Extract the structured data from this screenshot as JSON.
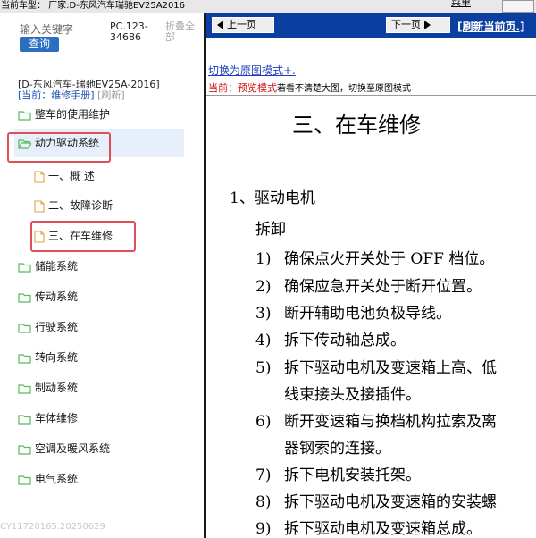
{
  "topbar": {
    "current_model": "当前车型： 厂家:D-东风汽车瑞驰EV25A2016",
    "menu_label": "菜单"
  },
  "left": {
    "search_label": "输入关键字",
    "search_button": "查询",
    "pc_code_line1": "PC.123-",
    "pc_code_line2": "34686",
    "fold_line1": "折叠全",
    "fold_line2": "部",
    "model_name": "[D-东风汽车-瑞驰EV25A-2016]",
    "mode_current": "[当前：维修手册]",
    "mode_refresh": "[刷新]",
    "tree": [
      {
        "label": "整车的使用维护"
      },
      {
        "label": "动力驱动系统"
      },
      {
        "label": "一、概 述"
      },
      {
        "label": "二、故障诊断"
      },
      {
        "label": "三、在车维修"
      },
      {
        "label": "储能系统"
      },
      {
        "label": "传动系统"
      },
      {
        "label": "行驶系统"
      },
      {
        "label": "转向系统"
      },
      {
        "label": "制动系统"
      },
      {
        "label": "车体维修"
      },
      {
        "label": "空调及暖风系统"
      },
      {
        "label": "电气系统"
      }
    ],
    "footer": "CY11720165.20250629"
  },
  "right": {
    "prev_label": "上一页",
    "next_label": "下一页",
    "home_link": "[刷新当前页.]",
    "switch_link": "切换为原图模式+.",
    "current_prefix": "当前：",
    "current_mode": "预览模式",
    "current_hint": "若看不清楚大图，切换至原图模式",
    "doc_title": "三、在车维修",
    "section": "1、驱动电机",
    "subsection": "拆卸",
    "steps": [
      {
        "n": "1)",
        "text": "确保点火开关处于 OFF 档位。"
      },
      {
        "n": "2)",
        "text": "确保应急开关处于断开位置。"
      },
      {
        "n": "3)",
        "text": "断开辅助电池负极导线。"
      },
      {
        "n": "4)",
        "text": "拆下传动轴总成。"
      },
      {
        "n": "5)",
        "text": "拆下驱动电机及变速箱上高、低"
      },
      {
        "n": "",
        "text": "线束接头及接插件。"
      },
      {
        "n": "6)",
        "text": "断开变速箱与换档机构拉索及离"
      },
      {
        "n": "",
        "text": "器钢索的连接。"
      },
      {
        "n": "7)",
        "text": "拆下电机安装托架。"
      },
      {
        "n": "8)",
        "text": "拆下驱动电机及变速箱的安装螺"
      },
      {
        "n": "9)",
        "text": "拆下驱动电机及变速箱总成。"
      }
    ]
  },
  "colors": {
    "accent": "#0a3ea0",
    "button": "#2b6fc2",
    "highlight": "#e04e5a",
    "folder": "#5cb85c",
    "doc": "#e8a040"
  }
}
